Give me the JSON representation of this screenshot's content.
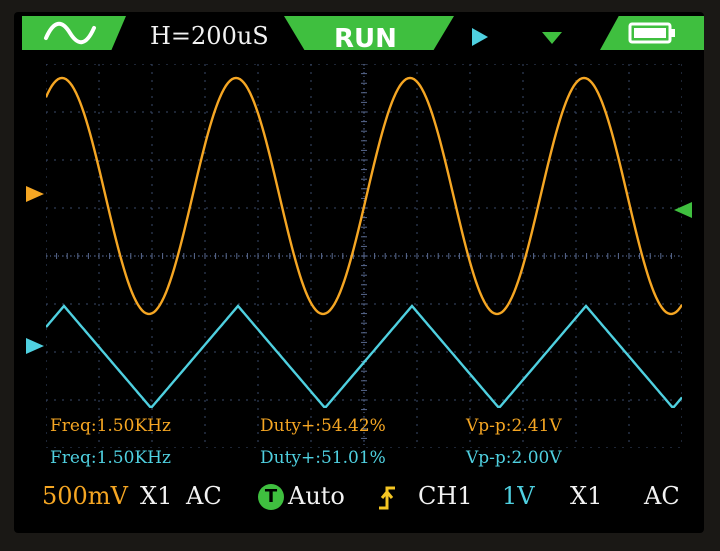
{
  "topbar": {
    "wave_icon": "sine-wave-icon",
    "timebase": "H=200uS",
    "status": "RUN",
    "trigger_pos_icon": "right-triangle-icon",
    "trigger_time_icon": "down-triangle-icon",
    "battery_icon": "battery-icon"
  },
  "measurements": {
    "ch1": {
      "freq": "Freq:1.50KHz",
      "duty": "Duty+:54.42%",
      "vpp": "Vp-p:2.41V"
    },
    "ch2": {
      "freq": "Freq:1.50KHz",
      "duty": "Duty+:51.01%",
      "vpp": "Vp-p:2.00V"
    }
  },
  "bottombar": {
    "ch1_volts": "500mV",
    "ch1_probe": "X1",
    "ch1_coupling": "AC",
    "trigger_badge": "T",
    "trigger_mode": "Auto",
    "trigger_source": "CH1",
    "ch2_volts": "1V",
    "ch2_probe": "X1",
    "ch2_coupling": "AC"
  },
  "colors": {
    "ch1": "#f5a623",
    "ch2": "#4fd0e0",
    "accent": "#3fbf3f",
    "grid": "#3a4a6a"
  }
}
